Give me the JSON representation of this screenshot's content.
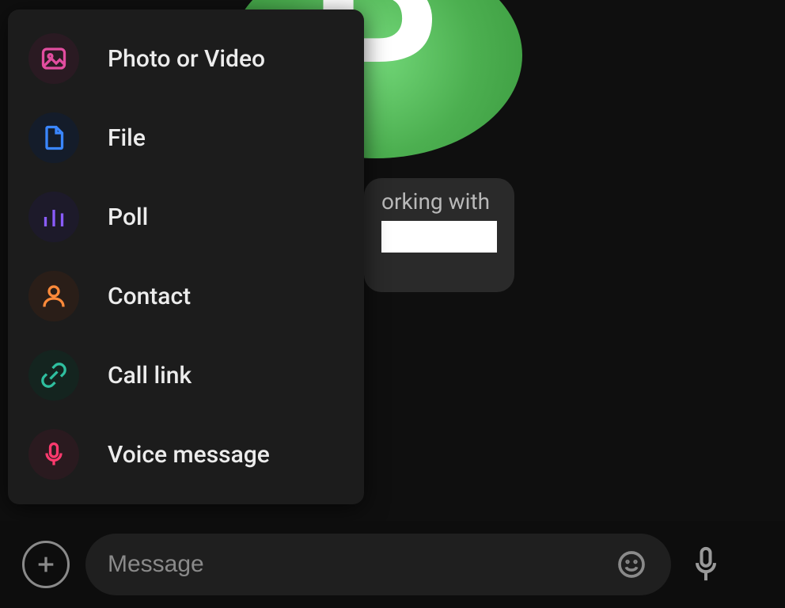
{
  "avatar": {
    "letter": "B"
  },
  "status": {
    "visible_text": "orking with"
  },
  "attach_menu": {
    "items": [
      {
        "icon": "photo-icon",
        "label": "Photo or Video"
      },
      {
        "icon": "file-icon",
        "label": "File"
      },
      {
        "icon": "poll-icon",
        "label": "Poll"
      },
      {
        "icon": "contact-icon",
        "label": "Contact"
      },
      {
        "icon": "call-link-icon",
        "label": "Call link"
      },
      {
        "icon": "voice-icon",
        "label": "Voice message"
      }
    ]
  },
  "input": {
    "placeholder": "Message"
  },
  "colors": {
    "photo": "#e24d9f",
    "file": "#3a86ff",
    "poll": "#8a5cff",
    "contact": "#ff8a3a",
    "call": "#2fbf9f",
    "voice": "#ff3a6e"
  }
}
